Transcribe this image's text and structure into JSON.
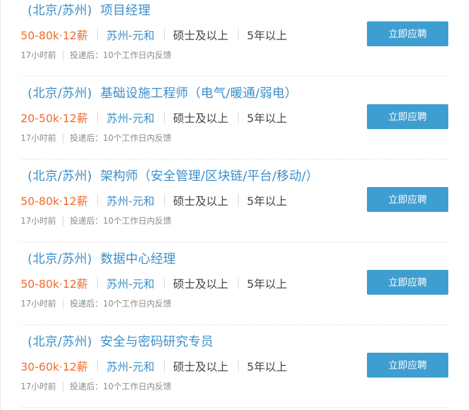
{
  "jobs": [
    {
      "location": "(北京/苏州)",
      "title": "项目经理",
      "salary": "50-80k·12薪",
      "city": "苏州-元和",
      "education": "硕士及以上",
      "experience": "5年以上",
      "posted": "17小时前",
      "feedback": "投递后：10个工作日内反馈",
      "apply_label": "立即应聘"
    },
    {
      "location": "(北京/苏州)",
      "title": "基础设施工程师（电气/暖通/弱电）",
      "salary": "20-50k·12薪",
      "city": "苏州-元和",
      "education": "硕士及以上",
      "experience": "5年以上",
      "posted": "17小时前",
      "feedback": "投递后：10个工作日内反馈",
      "apply_label": "立即应聘"
    },
    {
      "location": "(北京/苏州)",
      "title": "架构师（安全管理/区块链/平台/移动/）",
      "salary": "50-80k·12薪",
      "city": "苏州-元和",
      "education": "硕士及以上",
      "experience": "5年以上",
      "posted": "17小时前",
      "feedback": "投递后：10个工作日内反馈",
      "apply_label": "立即应聘"
    },
    {
      "location": "(北京/苏州)",
      "title": "数据中心经理",
      "salary": "50-80k·12薪",
      "city": "苏州-元和",
      "education": "硕士及以上",
      "experience": "5年以上",
      "posted": "17小时前",
      "feedback": "投递后：10个工作日内反馈",
      "apply_label": "立即应聘"
    },
    {
      "location": "(北京/苏州)",
      "title": "安全与密码研究专员",
      "salary": "30-60k·12薪",
      "city": "苏州-元和",
      "education": "硕士及以上",
      "experience": "5年以上",
      "posted": "17小时前",
      "feedback": "投递后：10个工作日内反馈",
      "apply_label": "立即应聘"
    }
  ],
  "colors": {
    "accent": "#3b8fc9",
    "salary": "#ef6c2b",
    "button": "#3f9ed0"
  }
}
